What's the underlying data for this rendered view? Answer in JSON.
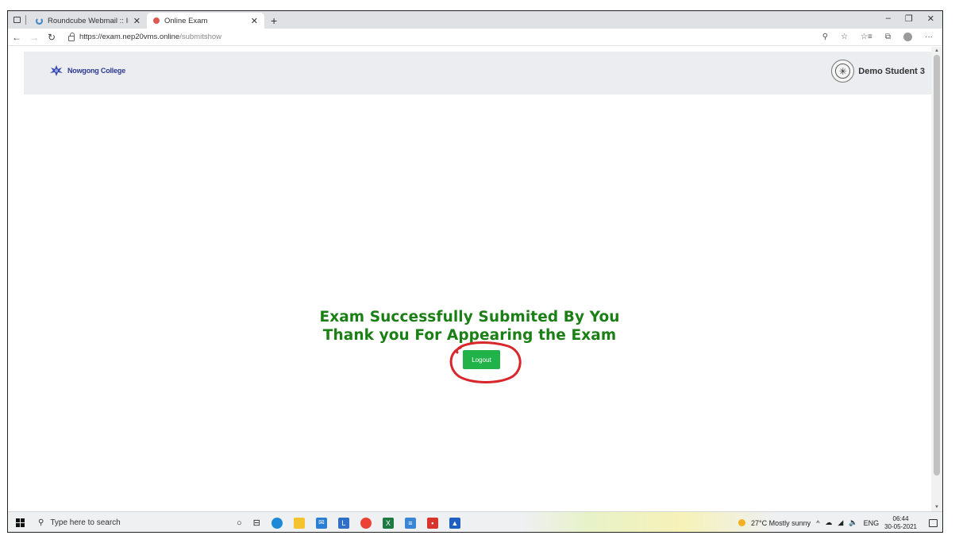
{
  "browser": {
    "tabs": [
      {
        "title": "Roundcube Webmail :: Inbox",
        "active": false
      },
      {
        "title": "Online Exam",
        "active": true
      }
    ],
    "new_tab": "+",
    "url_host": "https://exam.nep20vms.online",
    "url_path": "/submitshow",
    "window_controls": {
      "minimize": "–",
      "maximize": "❐",
      "close": "✕"
    }
  },
  "site": {
    "college_name": "Nowgong College",
    "user_name": "Demo Student 3"
  },
  "main": {
    "line1": "Exam Successfully Submited By You",
    "line2": "Thank you For Appearing the Exam",
    "logout_label": "Logout",
    "annotation_color": "#d9262b",
    "message_color": "#1a7f14",
    "button_color": "#21b34a"
  },
  "taskbar": {
    "search_placeholder": "Type here to search",
    "weather": "27°C  Mostly sunny",
    "language": "ENG",
    "time": "06:44",
    "date": "30-05-2021"
  }
}
